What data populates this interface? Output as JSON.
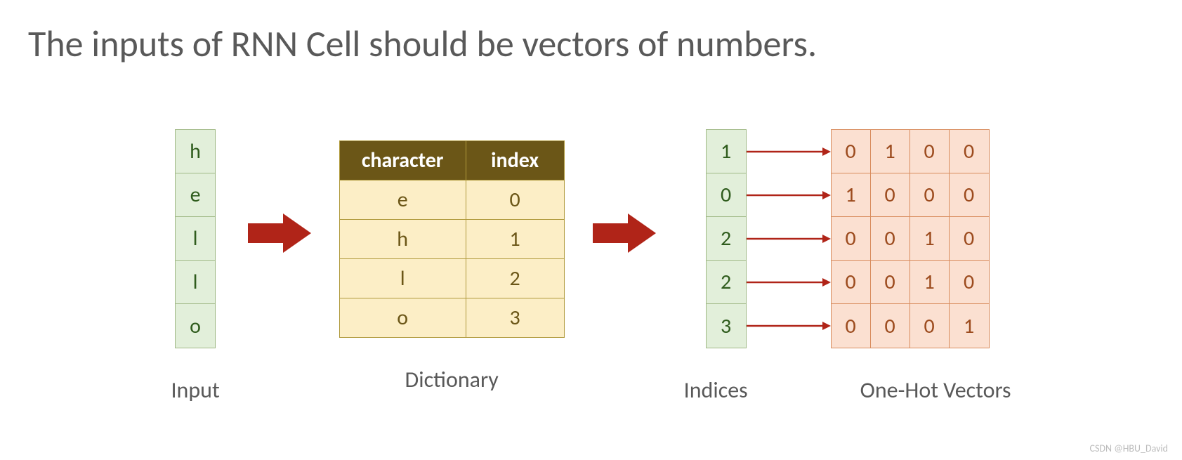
{
  "title": "The inputs of RNN Cell should be vectors of numbers.",
  "input": {
    "label": "Input",
    "chars": [
      "h",
      "e",
      "l",
      "l",
      "o"
    ]
  },
  "dictionary": {
    "label": "Dictionary",
    "headers": [
      "character",
      "index"
    ],
    "rows": [
      {
        "char": "e",
        "index": 0
      },
      {
        "char": "h",
        "index": 1
      },
      {
        "char": "l",
        "index": 2
      },
      {
        "char": "o",
        "index": 3
      }
    ]
  },
  "indices": {
    "label": "Indices",
    "values": [
      1,
      0,
      2,
      2,
      3
    ]
  },
  "onehot": {
    "label": "One-Hot Vectors",
    "vectors": [
      [
        0,
        1,
        0,
        0
      ],
      [
        1,
        0,
        0,
        0
      ],
      [
        0,
        0,
        1,
        0
      ],
      [
        0,
        0,
        1,
        0
      ],
      [
        0,
        0,
        0,
        1
      ]
    ]
  },
  "watermark": "CSDN @HBU_David",
  "colors": {
    "green_fill": "#e2efda",
    "green_border": "#a0b986",
    "brown_header": "#6b5617",
    "cream_fill": "#fceec6",
    "orange_fill": "#fbe0d1",
    "orange_border": "#d88b5c",
    "red_arrow": "#b02418"
  },
  "chart_data": {
    "type": "table",
    "description": "Character to index mapping and resulting one-hot encoding for the string 'hello'",
    "input_sequence": [
      "h",
      "e",
      "l",
      "l",
      "o"
    ],
    "char_to_index": {
      "e": 0,
      "h": 1,
      "l": 2,
      "o": 3
    },
    "index_sequence": [
      1,
      0,
      2,
      2,
      3
    ],
    "one_hot_vectors": [
      [
        0,
        1,
        0,
        0
      ],
      [
        1,
        0,
        0,
        0
      ],
      [
        0,
        0,
        1,
        0
      ],
      [
        0,
        0,
        1,
        0
      ],
      [
        0,
        0,
        0,
        1
      ]
    ]
  }
}
